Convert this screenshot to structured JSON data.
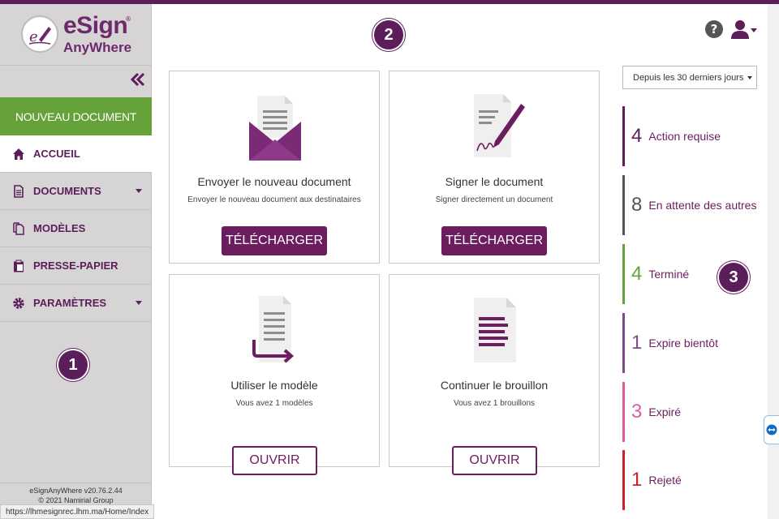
{
  "brand": {
    "name": "eSign",
    "registered": "®",
    "sub": "AnyWhere"
  },
  "colors": {
    "brand": "#5b1e5a",
    "button": "#6c1d5f",
    "new_doc": "#65a23a",
    "sidebar": "#d6d4d4"
  },
  "sidebar": {
    "new_document": "NOUVEAU DOCUMENT",
    "items": [
      {
        "label": "ACCUEIL",
        "icon": "home-icon",
        "active": true
      },
      {
        "label": "DOCUMENTS",
        "icon": "document-icon",
        "has_dropdown": true
      },
      {
        "label": "MODÈLES",
        "icon": "copy-icon"
      },
      {
        "label": "PRESSE-PAPIER",
        "icon": "clipboard-icon"
      },
      {
        "label": "PARAMÈTRES",
        "icon": "gear-icon",
        "has_dropdown": true
      }
    ],
    "version": "eSignAnyWhere v20.76.2.44",
    "copyright": "© 2021 Namirial Group"
  },
  "status_url": "https://lhmesignrec.lhm.ma/Home/Index",
  "badges": {
    "one": "1",
    "two": "2",
    "three": "3"
  },
  "cards": {
    "send": {
      "title": "Envoyer le nouveau document",
      "subtitle": "Envoyer le nouveau document aux destinataires",
      "button": "TÉLÉCHARGER",
      "icon": "envelope-document-icon"
    },
    "sign": {
      "title": "Signer le document",
      "subtitle": "Signer directement un document",
      "button": "TÉLÉCHARGER",
      "icon": "document-pen-icon"
    },
    "template": {
      "title": "Utiliser le modèle",
      "subtitle": "Vous avez 1 modèles",
      "button": "OUVRIR",
      "icon": "template-arrow-icon"
    },
    "draft": {
      "title": "Continuer le brouillon",
      "subtitle": "Vous avez 1 brouillons",
      "button": "OUVRIR",
      "icon": "draft-document-icon"
    }
  },
  "filter": {
    "selected": "Depuis les 30 derniers jours"
  },
  "stats": [
    {
      "count": "4",
      "label": "Action requise",
      "color": "#5b1e5a"
    },
    {
      "count": "8",
      "label": "En attente des autres",
      "color": "#555555"
    },
    {
      "count": "4",
      "label": "Terminé",
      "color": "#65a23a"
    },
    {
      "count": "1",
      "label": "Expire bientôt",
      "color": "#7e4a89"
    },
    {
      "count": "3",
      "label": "Expiré",
      "color": "#e05a9c"
    },
    {
      "count": "1",
      "label": "Rejeté",
      "color": "#d11f2a"
    }
  ]
}
